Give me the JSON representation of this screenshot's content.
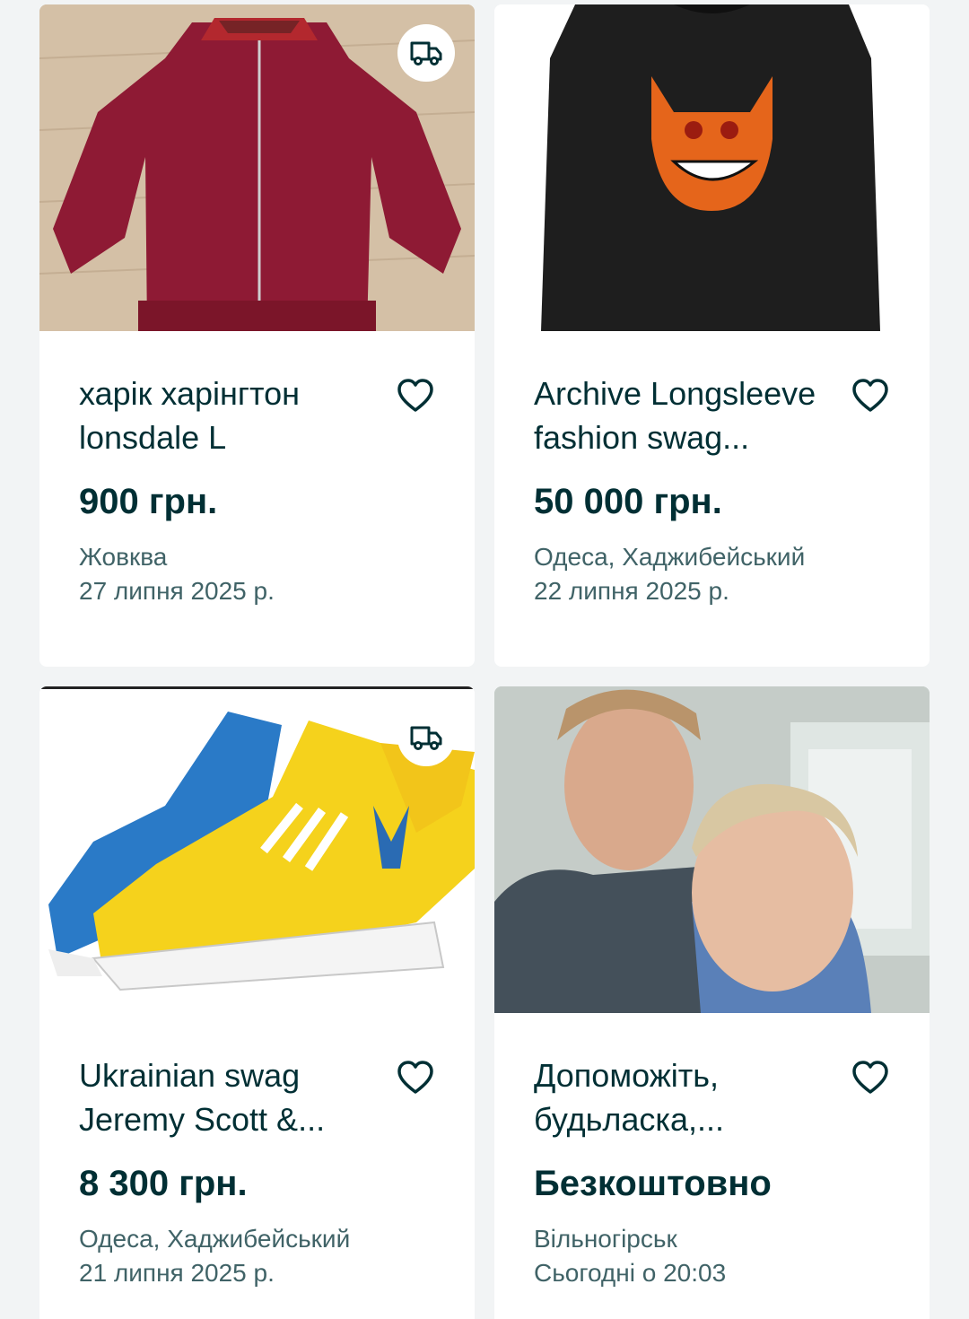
{
  "listings": [
    {
      "title": "харік харінгтон lonsdale L",
      "price": "900 грн.",
      "location": "Жовква",
      "date": "27 липня 2025 р.",
      "delivery": true
    },
    {
      "title": "Archive Longsleeve fashion swag...",
      "price": "50 000 грн.",
      "location": "Одеса, Хаджибейський",
      "date": "22 липня 2025 р.",
      "delivery": false
    },
    {
      "title": "Ukrainian swag Jeremy Scott &...",
      "price": "8 300 грн.",
      "location": "Одеса, Хаджибейський",
      "date": "21 липня 2025 р.",
      "delivery": true
    },
    {
      "title": "Допоможіть, будьласка,...",
      "price": "Безкоштовно",
      "location": "Вільногірськ",
      "date": "Сьогодні о 20:03",
      "delivery": false
    }
  ],
  "colors": {
    "text_dark": "#002f34",
    "text_muted": "#406367",
    "background": "#f2f4f5",
    "card": "#ffffff"
  },
  "icons": {
    "favorite": "heart-outline-icon",
    "delivery": "delivery-truck-icon"
  }
}
